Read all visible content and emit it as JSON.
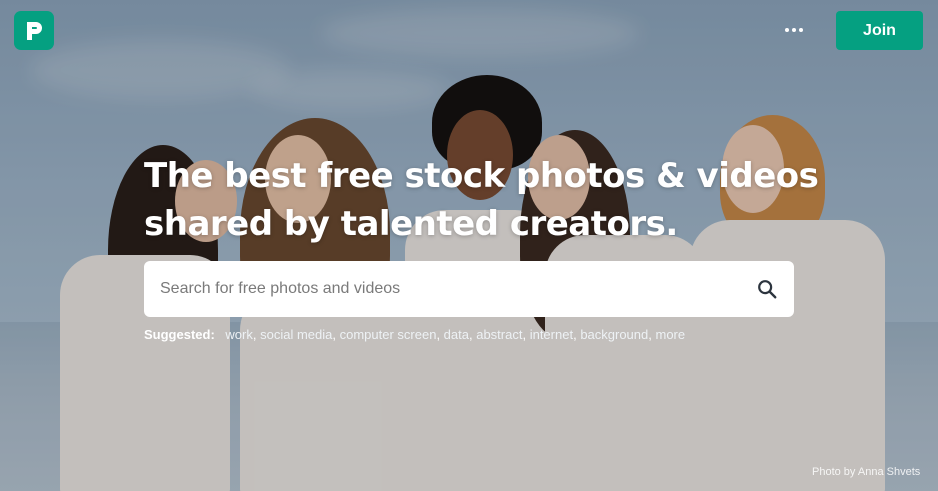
{
  "brand": {
    "name": "Pexels",
    "accent": "#05a081"
  },
  "header": {
    "more_icon": "ellipsis-icon",
    "join_label": "Join"
  },
  "hero": {
    "headline_line1": "The best free stock photos & videos",
    "headline_line2": "shared by talented creators.",
    "search": {
      "placeholder": "Search for free photos and videos",
      "value": "",
      "icon": "search-icon"
    },
    "suggested": {
      "label": "Suggested:",
      "items": [
        "work",
        "social media",
        "computer screen",
        "data",
        "abstract",
        "internet",
        "background"
      ],
      "more": "more"
    },
    "credit": "Photo by Anna Shvets"
  }
}
